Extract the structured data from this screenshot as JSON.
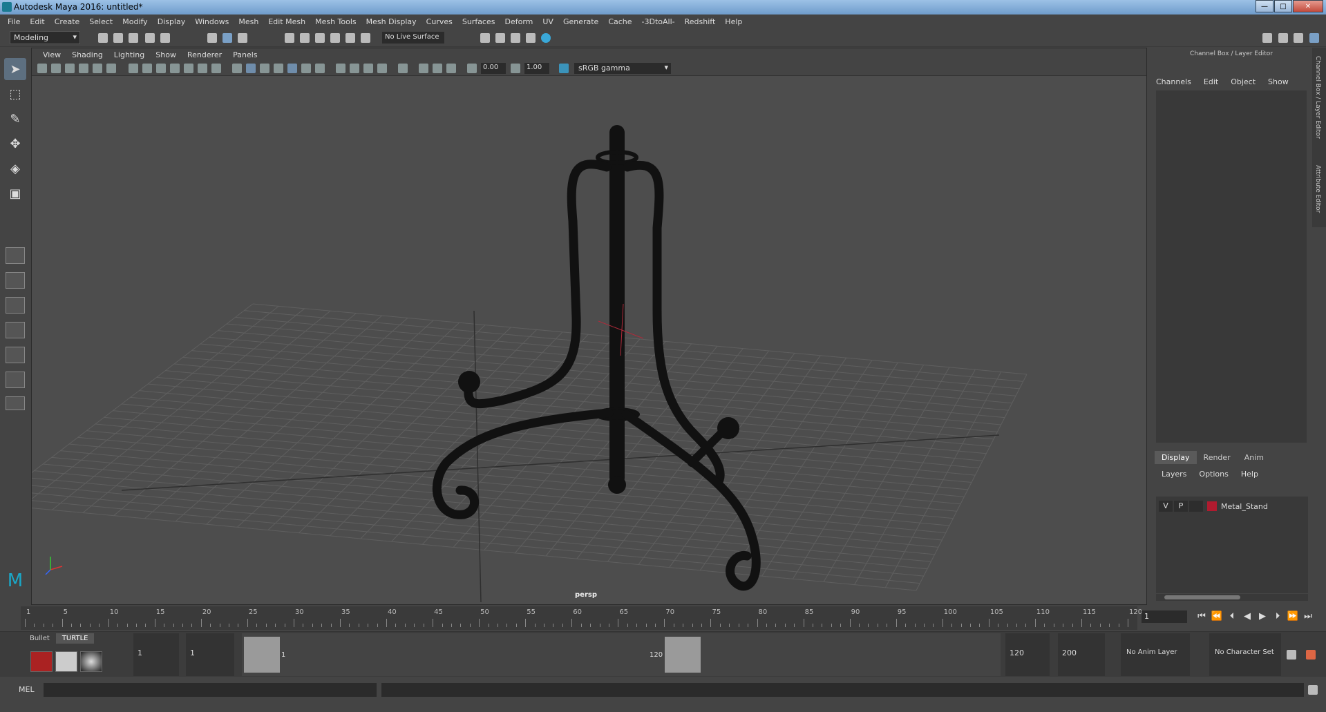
{
  "window": {
    "title": "Autodesk Maya 2016: untitled*",
    "buttons": [
      "—",
      "□",
      "✕"
    ]
  },
  "menubar": [
    "File",
    "Edit",
    "Create",
    "Select",
    "Modify",
    "Display",
    "Windows",
    "Mesh",
    "Edit Mesh",
    "Mesh Tools",
    "Mesh Display",
    "Curves",
    "Surfaces",
    "Deform",
    "UV",
    "Generate",
    "Cache",
    "-3DtoAll-",
    "Redshift",
    "Help"
  ],
  "shelf": {
    "mode": "Modeling",
    "live_surface": "No Live Surface"
  },
  "viewport": {
    "menu": [
      "View",
      "Shading",
      "Lighting",
      "Show",
      "Renderer",
      "Panels"
    ],
    "exposure": "0.00",
    "gamma_value": "1.00",
    "color_space": "sRGB gamma",
    "camera_label": "persp"
  },
  "right_panel": {
    "title": "Channel Box / Layer Editor",
    "menu": [
      "Channels",
      "Edit",
      "Object",
      "Show"
    ],
    "tabs": [
      "Display",
      "Render",
      "Anim"
    ],
    "layer_menu": [
      "Layers",
      "Options",
      "Help"
    ],
    "layer": {
      "v": "V",
      "p": "P",
      "name": "Metal_Stand",
      "color": "#b01b2f"
    },
    "side_tabs": [
      "Channel Box / Layer Editor",
      "Attribute Editor"
    ]
  },
  "timeline": {
    "ticks": [
      "1",
      "5",
      "10",
      "15",
      "20",
      "25",
      "30",
      "35",
      "40",
      "45",
      "50",
      "55",
      "60",
      "65",
      "70",
      "75",
      "80",
      "85",
      "90",
      "95",
      "100",
      "105",
      "110",
      "115",
      "120"
    ],
    "current_frame": "1"
  },
  "range": {
    "shelf_tabs": [
      "Bullet",
      "TURTLE"
    ],
    "start": "1",
    "playback_start": "1",
    "slider_start": "1",
    "slider_end": "120",
    "playback_end": "120",
    "end": "200",
    "anim_layer": "No Anim Layer",
    "character_set": "No Character Set"
  },
  "cmdline": {
    "label": "MEL"
  }
}
